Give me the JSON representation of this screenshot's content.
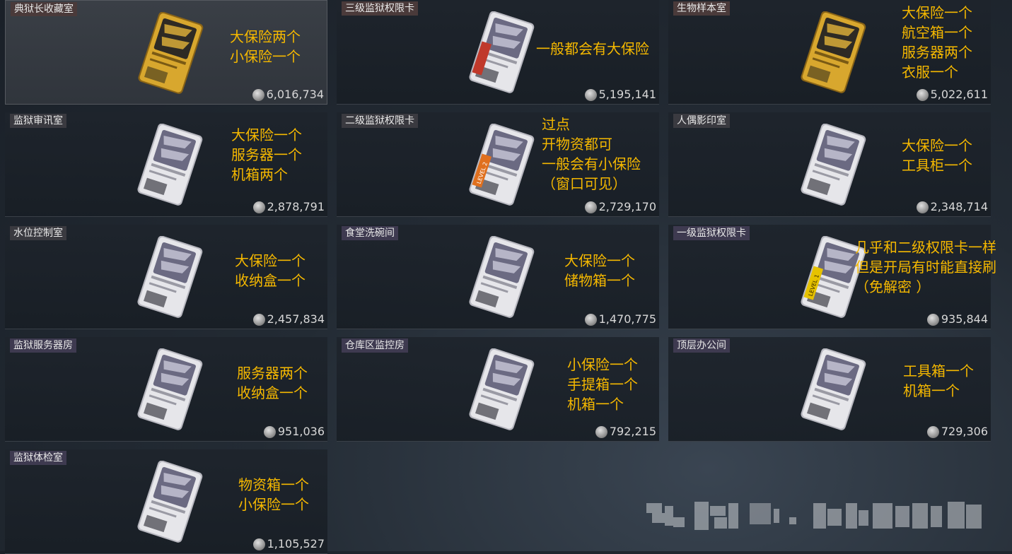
{
  "rooms": [
    {
      "name": "典狱长收藏室",
      "note": [
        "大保险两个",
        "小保险一个"
      ],
      "price": "6,016,734",
      "tag": "red",
      "card": "gold",
      "level": ""
    },
    {
      "name": "三级监狱权限卡",
      "note": [
        "一般都会有大保险"
      ],
      "price": "5,195,141",
      "tag": "red",
      "card": "red",
      "level": ""
    },
    {
      "name": "生物样本室",
      "note": [
        "大保险一个",
        "航空箱一个",
        "服务器两个",
        "衣服一个"
      ],
      "price": "5,022,611",
      "tag": "red",
      "card": "gold",
      "level": ""
    },
    {
      "name": "监狱审讯室",
      "note": [
        "大保险一个",
        "服务器一个",
        "机箱两个"
      ],
      "price": "2,878,791",
      "tag": "dark",
      "card": "white",
      "level": ""
    },
    {
      "name": "二级监狱权限卡",
      "note": [
        "过点",
        "开物资都可",
        "一般会有小保险",
        "（窗口可见）"
      ],
      "price": "2,729,170",
      "tag": "dark",
      "card": "orange",
      "level": "LEVEL 2"
    },
    {
      "name": "人偶影印室",
      "note": [
        "大保险一个",
        "工具柜一个"
      ],
      "price": "2,348,714",
      "tag": "dark",
      "card": "white",
      "level": ""
    },
    {
      "name": "水位控制室",
      "note": [
        "大保险一个",
        "收纳盒一个"
      ],
      "price": "2,457,834",
      "tag": "dark",
      "card": "white",
      "level": ""
    },
    {
      "name": "食堂洗碗间",
      "note": [
        "大保险一个",
        "储物箱一个"
      ],
      "price": "1,470,775",
      "tag": "purple",
      "card": "white",
      "level": ""
    },
    {
      "name": "一级监狱权限卡",
      "note": [
        "几乎和二级权限卡一样",
        "但是开局有时能直接刷",
        "（免解密 ）"
      ],
      "price": "935,844",
      "tag": "purple",
      "card": "yellow",
      "level": "LEVEL 1"
    },
    {
      "name": "监狱服务器房",
      "note": [
        "服务器两个",
        "收纳盒一个"
      ],
      "price": "951,036",
      "tag": "purple",
      "card": "white",
      "level": ""
    },
    {
      "name": "仓库区监控房",
      "note": [
        "小保险一个",
        "手提箱一个",
        "机箱一个"
      ],
      "price": "792,215",
      "tag": "purple",
      "card": "white",
      "level": ""
    },
    {
      "name": "顶层办公间",
      "note": [
        "工具箱一个",
        "机箱一个"
      ],
      "price": "729,306",
      "tag": "purple",
      "card": "white",
      "level": ""
    },
    {
      "name": "监狱体检室",
      "note": [
        "物资箱一个",
        "小保险一个"
      ],
      "price": "1,105,527",
      "tag": "purple",
      "card": "white",
      "level": ""
    }
  ],
  "colors": {
    "note": "#f5b800",
    "gold": "#d4a52a",
    "red_stripe": "#c0392b",
    "orange_stripe": "#e0701e",
    "yellow_stripe": "#e6c200"
  },
  "icons": {
    "coin": "coin-icon",
    "card": "keycard-icon"
  }
}
